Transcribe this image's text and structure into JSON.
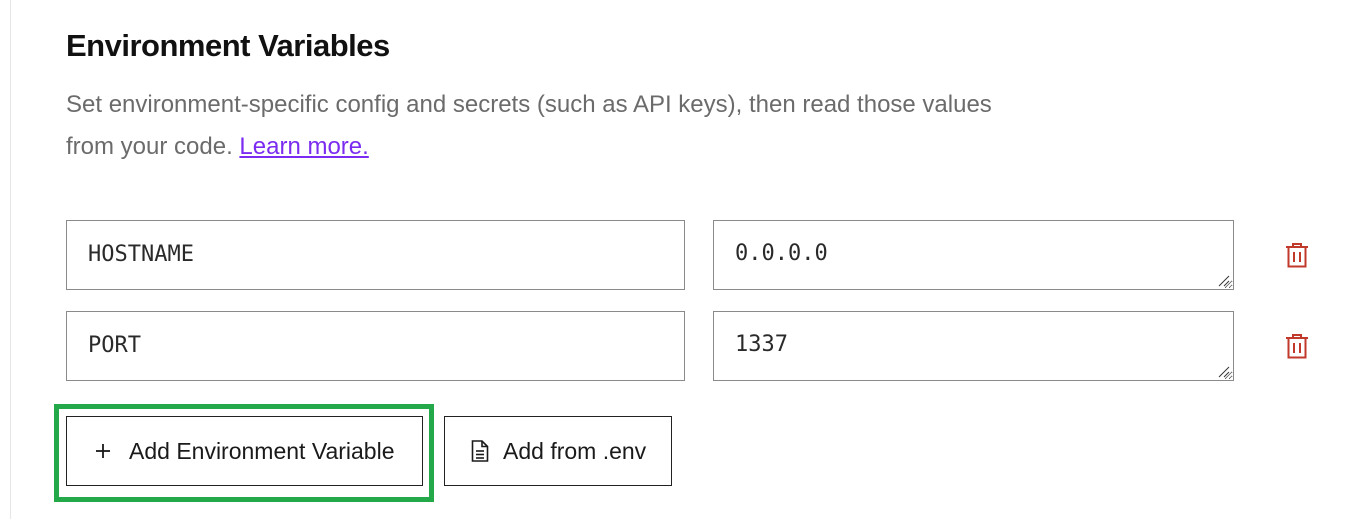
{
  "section": {
    "title": "Environment Variables",
    "description": "Set environment-specific config and secrets (such as API keys), then read those values from your code.",
    "learn_more_label": "Learn more."
  },
  "env_vars": [
    {
      "key": "HOSTNAME",
      "value": "0.0.0.0"
    },
    {
      "key": "PORT",
      "value": "1337"
    }
  ],
  "buttons": {
    "add_variable_label": "Add Environment Variable",
    "add_variable_icon": "plus-icon",
    "add_from_env_label": "Add from .env",
    "add_from_env_icon": "file-icon",
    "delete_icon": "trash-icon"
  },
  "colors": {
    "link": "#7b2cf0",
    "delete": "#c0392b",
    "highlight": "#23a84a"
  }
}
